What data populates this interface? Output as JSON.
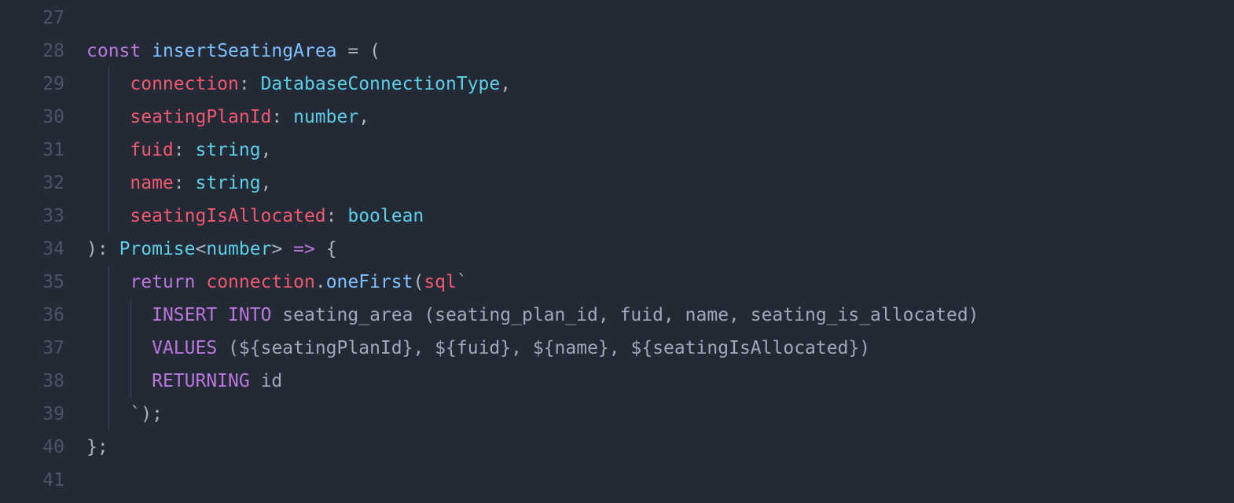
{
  "lines": {
    "n27": "27",
    "n28": "28",
    "n29": "29",
    "n30": "30",
    "n31": "31",
    "n32": "32",
    "n33": "33",
    "n34": "34",
    "n35": "35",
    "n36": "36",
    "n37": "37",
    "n38": "38",
    "n39": "39",
    "n40": "40",
    "n41": "41"
  },
  "t": {
    "const": "const",
    "sp": " ",
    "sp2": "  ",
    "sp4": "    ",
    "sp6": "      ",
    "insertSeatingArea": "insertSeatingArea",
    "eq": " = ",
    "lparen": "(",
    "rparen": ")",
    "colon_sp": ": ",
    "comma": ",",
    "connection": "connection",
    "DatabaseConnectionType": "DatabaseConnectionType",
    "seatingPlanId": "seatingPlanId",
    "number": "number",
    "fuid": "fuid",
    "string": "string",
    "name": "name",
    "seatingIsAllocated": "seatingIsAllocated",
    "boolean": "boolean",
    "Promise": "Promise",
    "lt": "<",
    "gt": ">",
    "arrow": " => ",
    "lbrace": "{",
    "rbrace": "}",
    "return": "return",
    "dot": ".",
    "oneFirst": "oneFirst",
    "sql": "sql",
    "backtick": "`",
    "INSERT": "INSERT",
    "INTO": "INTO",
    "seating_area": "seating_area",
    "col_list": " (seating_plan_id, fuid, name, seating_is_allocated)",
    "VALUES": "VALUES",
    "interp_open": "${",
    "interp_close": "}",
    "paren_open_sp": " (",
    "close_paren": ")",
    "comma_sp": ", ",
    "RETURNING": "RETURNING",
    "id": " id",
    "rparen_semi": ");",
    "rbrace_semi": "};"
  }
}
